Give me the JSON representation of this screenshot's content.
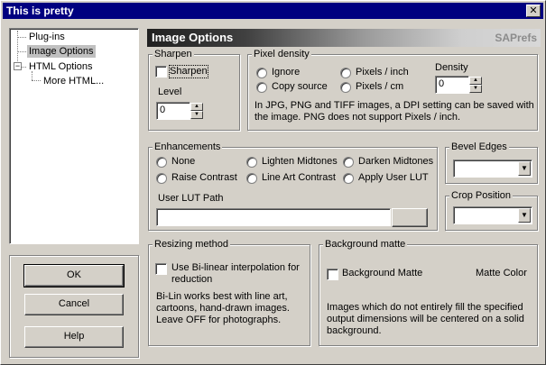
{
  "window": {
    "title": "This is pretty",
    "close_glyph": "✕"
  },
  "tree": {
    "items": [
      {
        "label": "Plug-ins"
      },
      {
        "label": "Image Options"
      },
      {
        "label": "HTML Options"
      },
      {
        "label": "More HTML..."
      }
    ],
    "selected": "Image Options"
  },
  "buttons": {
    "ok": "OK",
    "cancel": "Cancel",
    "help": "Help"
  },
  "header": {
    "title": "Image Options",
    "brand": "SAPrefs"
  },
  "sharpen": {
    "group_label": "Sharpen",
    "checkbox_label": "Sharpen",
    "checked": false,
    "level_label": "Level",
    "level_value": "0"
  },
  "pixel_density": {
    "group_label": "Pixel density",
    "options": [
      "Ignore",
      "Copy source",
      "Pixels / inch",
      "Pixels / cm"
    ],
    "density_label": "Density",
    "density_value": "0",
    "note": "In JPG, PNG and TIFF images, a DPI setting can be saved with the image. PNG does not support Pixels / inch."
  },
  "enhancements": {
    "group_label": "Enhancements",
    "options": [
      "None",
      "Lighten Midtones",
      "Darken Midtones",
      "Raise Contrast",
      "Line Art Contrast",
      "Apply User LUT"
    ],
    "lut_label": "User LUT Path",
    "lut_value": ""
  },
  "bevel": {
    "group_label": "Bevel Edges",
    "value": ""
  },
  "crop": {
    "group_label": "Crop Position",
    "value": ""
  },
  "resizing": {
    "group_label": "Resizing method",
    "checkbox_label": "Use Bi-linear interpolation for reduction",
    "checked": false,
    "note": "Bi-Lin works best with line art, cartoons, hand-drawn images. Leave OFF for photographs."
  },
  "background": {
    "group_label": "Background matte",
    "checkbox_label": "Background Matte",
    "checked": false,
    "color_label": "Matte Color",
    "note": "Images which do not entirely fill the specified output dimensions will be centered on a solid background."
  },
  "colors": {
    "title_bar": "#000080",
    "face": "#d4d0c8"
  },
  "icons": {
    "close": "close-icon",
    "dropdown": "chevron-down-icon",
    "spin_up": "triangle-up-icon",
    "spin_down": "triangle-down-icon"
  }
}
